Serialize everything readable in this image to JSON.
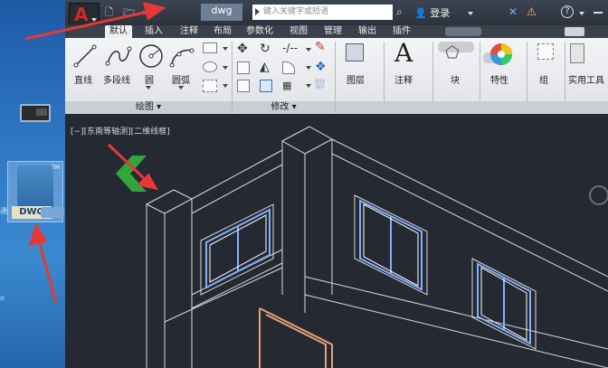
{
  "desktop": {
    "dwg_icon_label": "DWG",
    "dwg_tm": "TM",
    "side_text_1": "通",
    "side_text_2": "o"
  },
  "titlebar": {
    "filename": "dwg",
    "search_placeholder": "键入关键字或短语",
    "login_label": "登录",
    "help_label": "?",
    "qa_new": "🗋",
    "qa_open": "🗁",
    "qa_more": "»"
  },
  "tabs": [
    {
      "label": "默认"
    },
    {
      "label": "插入"
    },
    {
      "label": "注释"
    },
    {
      "label": "布局"
    },
    {
      "label": "参数化"
    },
    {
      "label": "视图"
    },
    {
      "label": "管理"
    },
    {
      "label": "输出"
    },
    {
      "label": "插件"
    }
  ],
  "ribbon": {
    "draw_tools": {
      "line": "直线",
      "polyline": "多段线",
      "circle": "圆",
      "arc": "圆弧"
    },
    "layers": "图层",
    "annotation": "注释",
    "block": "块",
    "properties": "特性",
    "group": "组",
    "utilities": "实用工具",
    "panels": {
      "draw": "绘图",
      "modify": "修改"
    },
    "annotation_letter": "A"
  },
  "viewport": {
    "label": "[−][东南等轴测][二维线框]"
  },
  "colors": {
    "app_bg": "#2d2f36",
    "canvas_bg": "#252931",
    "ribbon_bg": "#e9ebee",
    "accent_red": "#d3282b",
    "viewcube_green": "#31a63a",
    "annotation_arrow": "#e53935"
  }
}
